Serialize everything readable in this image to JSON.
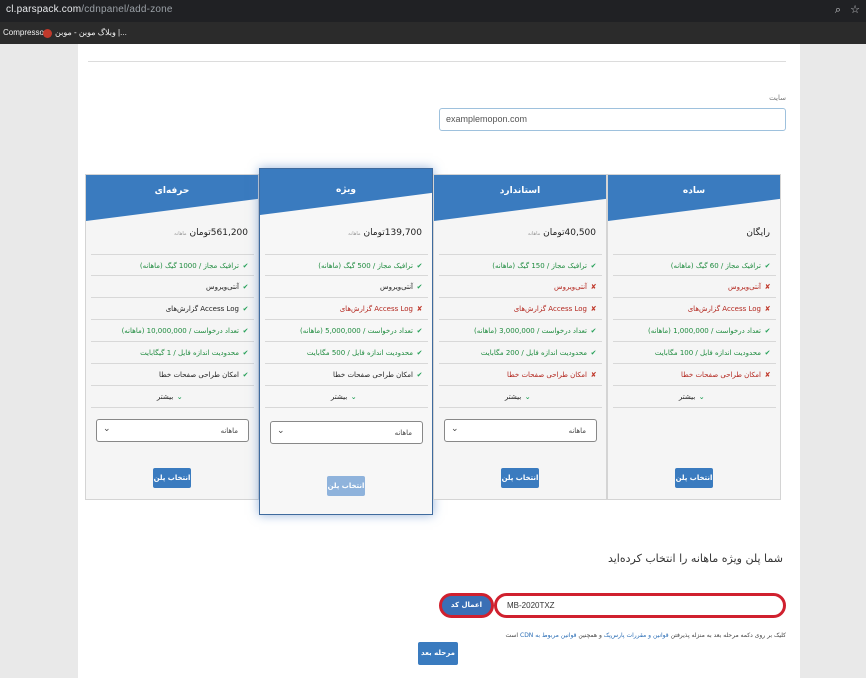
{
  "browser": {
    "url_host": "cl.parspack.com",
    "url_path": "/cdnpanel/add-zone",
    "bookmarks": [
      "Compressor",
      "وبلاگ موبن - موبن |..."
    ]
  },
  "form": {
    "site_label": "سایت",
    "site_value": "examplemopon.com"
  },
  "plans": [
    {
      "title": "حرفه‌ای",
      "price": "561,200",
      "currency": "تومان",
      "period": "ماهانه",
      "features": [
        {
          "mark": "✔",
          "text": "ترافیک مجاز / 1000 گیگ (ماهانه)"
        },
        {
          "mark": "✔",
          "text": "آنتی‌ویروس"
        },
        {
          "mark": "✔",
          "text": "گزارش‌های Access Log"
        },
        {
          "mark": "✔",
          "text": "تعداد درخواست / 10,000,000 (ماهانه)"
        },
        {
          "mark": "✔",
          "text": "محدودیت اندازه فایل / 1 گیگابایت"
        },
        {
          "mark": "✔",
          "text": "امکان طراحی صفحات خطا"
        },
        {
          "mark": "⌄",
          "text": "بیشتر"
        }
      ],
      "select_value": "ماهانه",
      "button": "انتخاب پلن"
    },
    {
      "title": "ویژه",
      "price": "139,700",
      "currency": "تومان",
      "period": "ماهانه",
      "features": [
        {
          "mark": "✔",
          "text": "ترافیک مجاز / 500 گیگ (ماهانه)"
        },
        {
          "mark": "✔",
          "text": "آنتی‌ویروس"
        },
        {
          "mark": "✘",
          "text": "گزارش‌های Access Log"
        },
        {
          "mark": "✔",
          "text": "تعداد درخواست / 5,000,000 (ماهانه)"
        },
        {
          "mark": "✔",
          "text": "محدودیت اندازه فایل / 500 مگابایت"
        },
        {
          "mark": "✔",
          "text": "امکان طراحی صفحات خطا"
        },
        {
          "mark": "⌄",
          "text": "بیشتر"
        }
      ],
      "select_value": "ماهانه",
      "button": "انتخاب پلن"
    },
    {
      "title": "استاندارد",
      "price": "40,500",
      "currency": "تومان",
      "period": "ماهانه",
      "features": [
        {
          "mark": "✔",
          "text": "ترافیک مجاز / 150 گیگ (ماهانه)"
        },
        {
          "mark": "✘",
          "text": "آنتی‌ویروس"
        },
        {
          "mark": "✘",
          "text": "گزارش‌های Access Log"
        },
        {
          "mark": "✔",
          "text": "تعداد درخواست / 3,000,000 (ماهانه)"
        },
        {
          "mark": "✔",
          "text": "محدودیت اندازه فایل / 200 مگابایت"
        },
        {
          "mark": "✘",
          "text": "امکان طراحی صفحات خطا"
        },
        {
          "mark": "⌄",
          "text": "بیشتر"
        }
      ],
      "select_value": "ماهانه",
      "button": "انتخاب پلن"
    },
    {
      "title": "ساده",
      "price": "رایگان",
      "currency": "",
      "period": "",
      "features": [
        {
          "mark": "✔",
          "text": "ترافیک مجاز / 60 گیگ (ماهانه)"
        },
        {
          "mark": "✘",
          "text": "آنتی‌ویروس"
        },
        {
          "mark": "✘",
          "text": "گزارش‌های Access Log"
        },
        {
          "mark": "✔",
          "text": "تعداد درخواست / 1,000,000 (ماهانه)"
        },
        {
          "mark": "✔",
          "text": "محدودیت اندازه فایل / 100 مگابایت"
        },
        {
          "mark": "✘",
          "text": "امکان طراحی صفحات خطا"
        },
        {
          "mark": "⌄",
          "text": "بیشتر"
        }
      ],
      "select_value": "",
      "button": "انتخاب پلن"
    }
  ],
  "summary": {
    "selected_message": "شما پلن ویژه ماهانه را انتخاب کرده‌اید",
    "coupon_value": "MB-2020TXZ",
    "apply_button": "اعمال کد تخفیف",
    "terms_pre": "کلیک بر روی دکمه مرحله بعد به منزله پذیرفتن",
    "terms_link1": "قوانین و مقررات پارس‌پک",
    "terms_mid": "و همچنین",
    "terms_link2": "قوانین مربوط به CDN",
    "terms_post": "است",
    "next_button": "مرحله بعد"
  },
  "colors": {
    "header_blue": "#3a7bbf",
    "highlight_red": "#d0202e",
    "check_green": "#27a15a",
    "cross_red": "#c0392b"
  }
}
